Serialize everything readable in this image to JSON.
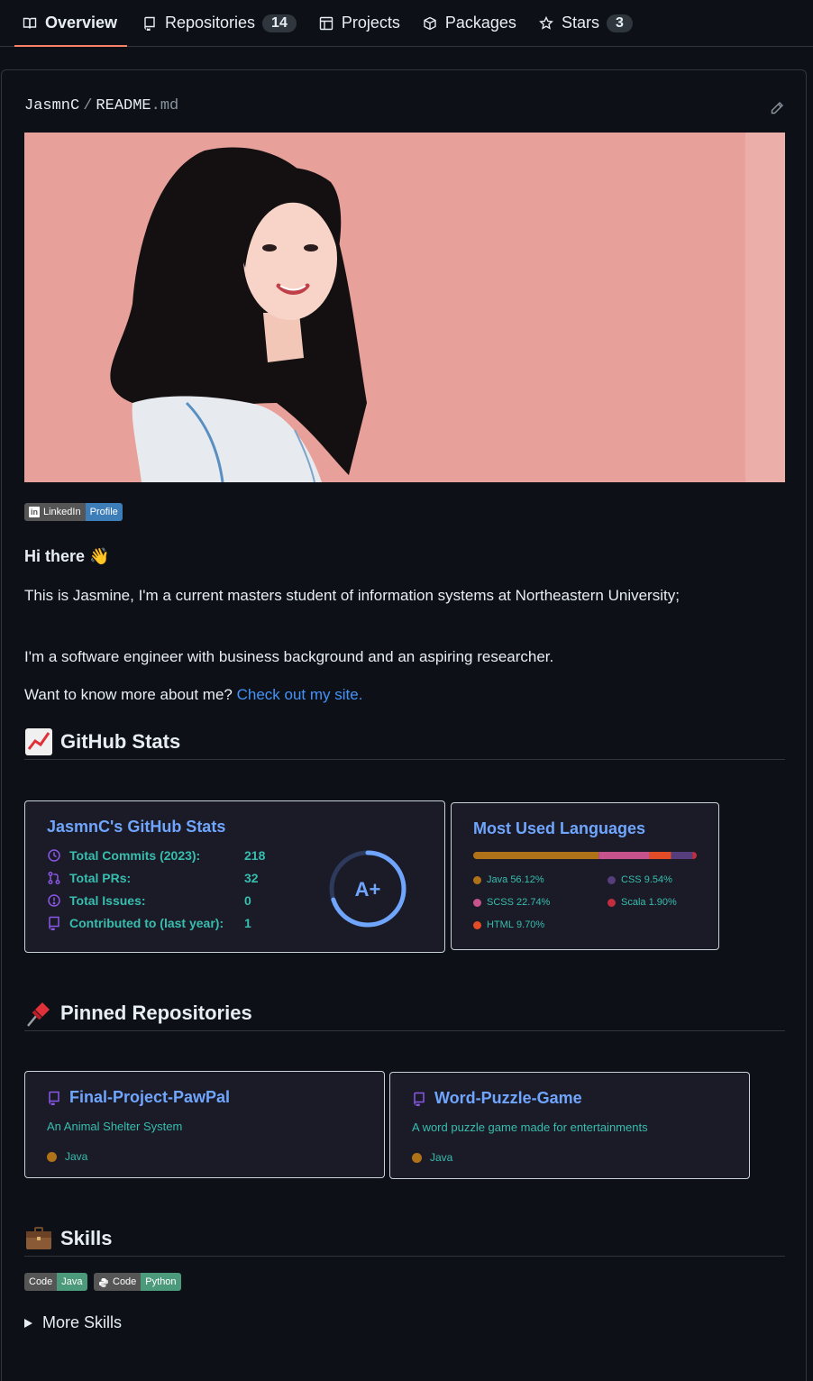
{
  "tabs": [
    {
      "label": "Overview",
      "icon": "book-icon",
      "active": true
    },
    {
      "label": "Repositories",
      "icon": "repo-icon",
      "count": "14"
    },
    {
      "label": "Projects",
      "icon": "table-icon"
    },
    {
      "label": "Packages",
      "icon": "package-icon"
    },
    {
      "label": "Stars",
      "icon": "star-icon",
      "count": "3"
    }
  ],
  "readme": {
    "user": "JasmnC",
    "sep": "/",
    "file": "README",
    "ext": ".md",
    "edit_icon": "pencil-icon"
  },
  "linkedin_badge": {
    "left": "LinkedIn",
    "right": "Profile",
    "color": "#3d7db8"
  },
  "intro": {
    "heading": "Hi there 👋",
    "p1": "This is Jasmine, I'm a current masters student of information systems at Northeastern University;",
    "p2": "I'm a software engineer with business background and an aspiring researcher.",
    "p3_text": "Want to know more about me? ",
    "p3_link": "Check out my site."
  },
  "sections": {
    "stats": "GitHub Stats",
    "pinned": "Pinned Repositories",
    "skills": "Skills"
  },
  "stats_card": {
    "title": "JasmnC's GitHub Stats",
    "rows": [
      {
        "label": "Total Commits (2023):",
        "value": "218",
        "icon": "history-icon"
      },
      {
        "label": "Total PRs:",
        "value": "32",
        "icon": "pull-request-icon"
      },
      {
        "label": "Total Issues:",
        "value": "0",
        "icon": "issue-icon"
      },
      {
        "label": "Contributed to (last year):",
        "value": "1",
        "icon": "repo-icon"
      }
    ],
    "grade": "A+",
    "grade_progress": 0.7
  },
  "languages_card": {
    "title": "Most Used Languages",
    "langs": [
      {
        "name": "Java",
        "percent": "56.12%",
        "value": 56.12,
        "color": "#b07219"
      },
      {
        "name": "SCSS",
        "percent": "22.74%",
        "value": 22.74,
        "color": "#c6538c"
      },
      {
        "name": "HTML",
        "percent": "9.70%",
        "value": 9.7,
        "color": "#e34c26"
      },
      {
        "name": "CSS",
        "percent": "9.54%",
        "value": 9.54,
        "color": "#563d7c"
      },
      {
        "name": "Scala",
        "percent": "1.90%",
        "value": 1.9,
        "color": "#c22d40"
      }
    ]
  },
  "pinned": [
    {
      "name": "Final-Project-PawPal",
      "desc": "An Animal Shelter System",
      "lang": "Java",
      "lang_color": "#b07219"
    },
    {
      "name": "Word-Puzzle-Game",
      "desc": "A word puzzle game made for entertainments",
      "lang": "Java",
      "lang_color": "#b07219"
    }
  ],
  "skills": [
    {
      "left": "Code",
      "right": "Java",
      "color": "#4c9a7c"
    },
    {
      "left": "Code",
      "right": "Python",
      "color": "#4c9a7c",
      "icon": "python-icon"
    }
  ],
  "more_skills": "More Skills"
}
